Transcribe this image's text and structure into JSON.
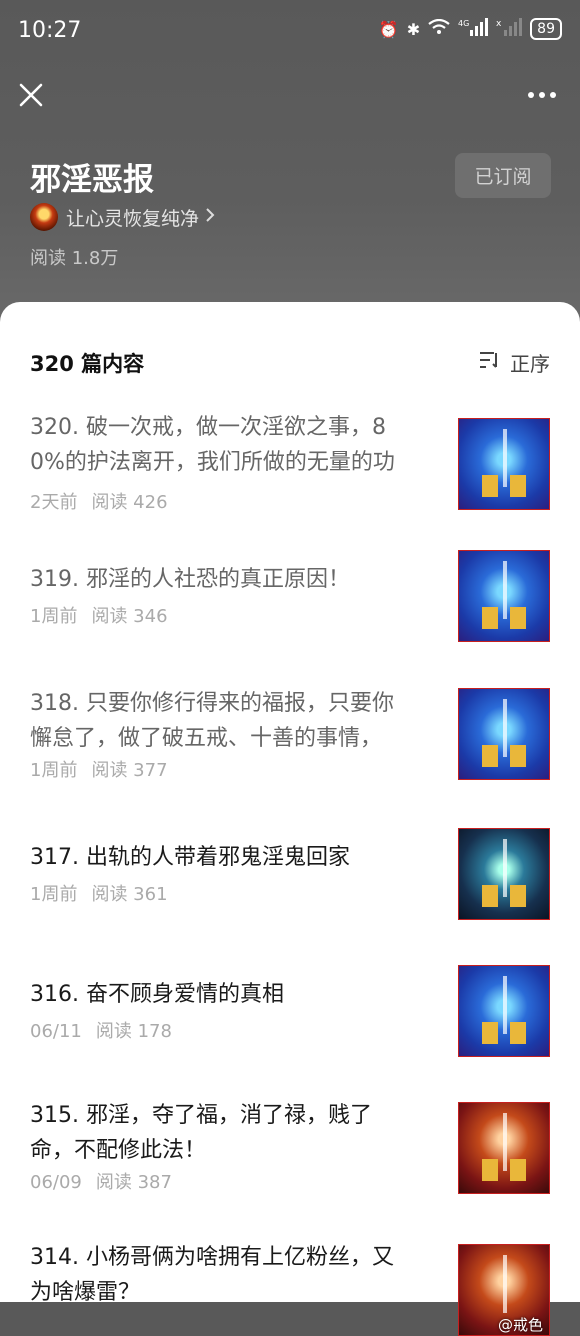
{
  "status": {
    "time": "10:27",
    "battery": "89"
  },
  "header": {
    "title": "邪淫恶报",
    "subscribe_label": "已订阅",
    "author": "让心灵恢复纯净",
    "read_label": "阅读 1.8万"
  },
  "list": {
    "count_label": "320 篇内容",
    "order_label": "正序",
    "items": [
      {
        "line1": "320. 破一次戒，做一次淫欲之事，8",
        "line2": "0%的护法离开，我们所做的无量的功",
        "date": "2天前",
        "reads": "阅读 426"
      },
      {
        "line1": "319. 邪淫的人社恐的真正原因！",
        "line2": "",
        "date": "1周前",
        "reads": "阅读 346"
      },
      {
        "line1": "318. 只要你修行得来的福报，只要你",
        "line2": "懈怠了，做了破五戒、十善的事情，",
        "date": "1周前",
        "reads": "阅读 377"
      },
      {
        "line1": "317. 出轨的人带着邪鬼淫鬼回家",
        "line2": "",
        "date": "1周前",
        "reads": "阅读 361"
      },
      {
        "line1": "316. 奋不顾身爱情的真相",
        "line2": "",
        "date": "06/11",
        "reads": "阅读 178"
      },
      {
        "line1": "315. 邪淫，夺了福，消了禄，贱了",
        "line2": "命，不配修此法！",
        "date": "06/09",
        "reads": "阅读 387"
      },
      {
        "line1": "314. 小杨哥俩为啥拥有上亿粉丝，又",
        "line2": "为啥爆雷？",
        "date": "",
        "reads": ""
      }
    ]
  },
  "watermark": "@戒色",
  "icons": {
    "close": "close-icon",
    "more": "more-icon",
    "sort": "sort-icon",
    "chevron": "chevron-right-icon"
  }
}
